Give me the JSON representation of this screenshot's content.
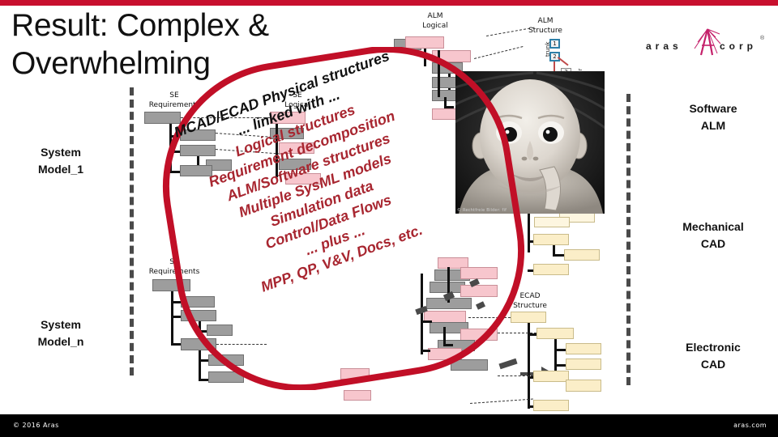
{
  "slide": {
    "title": "Result: Complex &\nOverwhelming",
    "title_line1": "Result: Complex &",
    "title_line2": "Overwhelming",
    "accent_color": "#c8102e",
    "red_text_color": "#a82630"
  },
  "logo": {
    "left_word": "aras",
    "right_word": "corp",
    "registered_mark": "®",
    "mark_name": "aras-starburst-logo"
  },
  "left_labels": [
    {
      "id": "system-model-1",
      "line1": "System",
      "line2": "Model_1"
    },
    {
      "id": "system-model-n",
      "line1": "System",
      "line2": "Model_n"
    }
  ],
  "right_labels": [
    {
      "id": "software-alm",
      "line1": "Software",
      "line2": "ALM"
    },
    {
      "id": "mechanical-cad",
      "line1": "Mechanical",
      "line2": "CAD"
    },
    {
      "id": "electronic-cad",
      "line1": "Electronic",
      "line2": "CAD"
    }
  ],
  "trees": [
    {
      "id": "se-requirements-1",
      "line1": "SE",
      "line2": "Requirements"
    },
    {
      "id": "se-logical-1",
      "line1": "SE",
      "line2": "Logical"
    },
    {
      "id": "alm-logical",
      "line1": "ALM",
      "line2": "Logical"
    },
    {
      "id": "alm-structure",
      "line1": "ALM",
      "line2": "Structure"
    },
    {
      "id": "se-requirements-n",
      "line1": "SE",
      "line2": "Requirements"
    },
    {
      "id": "ecad-structure",
      "line1": "ECAD",
      "line2": "Structure"
    }
  ],
  "alm_structure_nodes": {
    "trunk_label": "trunk",
    "branch_label": "br",
    "items": [
      "1",
      "2",
      "3"
    ]
  },
  "callout": {
    "lines": [
      {
        "text": "MCAD/ECAD Physical structures",
        "color": "black"
      },
      {
        "text": "... linked with ...",
        "color": "black"
      },
      {
        "text": "Logical structures",
        "color": "red"
      },
      {
        "text": "Requirement decomposition",
        "color": "red"
      },
      {
        "text": "ALM/Software structures",
        "color": "red"
      },
      {
        "text": "Multiple SysML models",
        "color": "red"
      },
      {
        "text": "Simulation data",
        "color": "red"
      },
      {
        "text": "Control/Data Flows",
        "color": "red"
      },
      {
        "text": "... plus ...",
        "color": "red"
      },
      {
        "text": "MPP, QP, V&V, Docs, etc.",
        "color": "red"
      }
    ]
  },
  "image": {
    "alt": "surprised-baby-photo",
    "credit": "© Rechtfreie Bilder: fif"
  },
  "footer": {
    "copyright": "© 2016 Aras",
    "website": "aras.com"
  }
}
